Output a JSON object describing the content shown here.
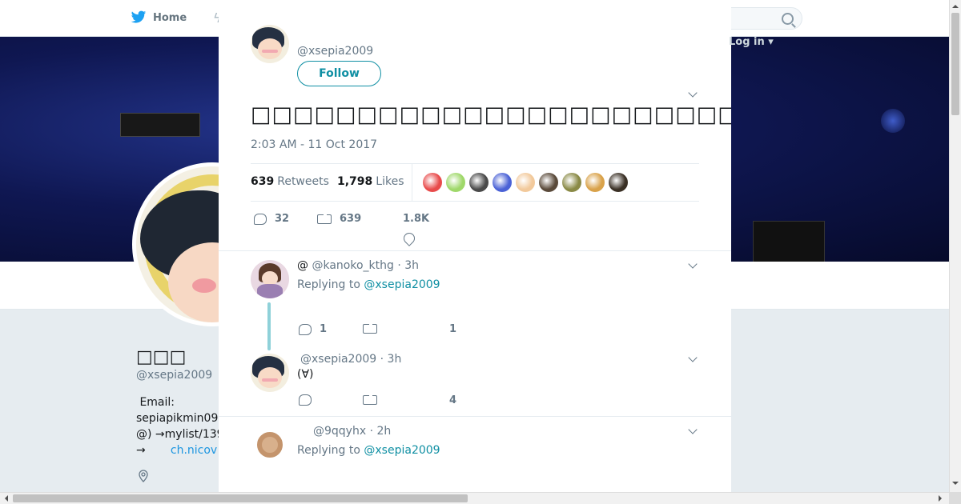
{
  "topnav": {
    "home_label": "Home",
    "login_label": "Log in ▾"
  },
  "profile": {
    "name": "□□□",
    "handle": "@xsepia2009",
    "bio_line1": " Email:",
    "bio_line2": "sepiapikmin09",
    "bio_line3": "@) →mylist/139",
    "bio_line4_prefix": "→",
    "bio_link": "ch.nicov"
  },
  "tweet": {
    "author_handle": "@xsepia2009",
    "follow_label": "Follow",
    "text": "□□□□□□□□□□□□□□□□□□□□□□□□□□□□□□□□□□□□□□□□□□□□□(□)□□□□□□(□)□□□□□□□□□□□□□□□",
    "timestamp": "2:03 AM - 11 Oct 2017",
    "retweets_count": "639",
    "retweets_label": "Retweets",
    "likes_count": "1,798",
    "likes_label": "Likes",
    "liker_colors": [
      "#e84b4b",
      "#9fd86a",
      "#4a4a4a",
      "#4b62d6",
      "#f2c99b",
      "#5a4a3a",
      "#8a8a46",
      "#d9a24a",
      "#3a3025"
    ],
    "reply_count": "32",
    "retweet_action_count": "639",
    "like_action_count": "1.8K"
  },
  "replies": [
    {
      "name": "@",
      "handle": "@kanoko_kthg",
      "time": "3h",
      "replying_prefix": "Replying to",
      "replying_to": "@xsepia2009",
      "reply_count": "1",
      "like_count": "1"
    },
    {
      "handle": "@xsepia2009",
      "time": "3h",
      "text": "(∀)",
      "like_count": "4"
    },
    {
      "handle": "@9qqyhx",
      "time": "2h",
      "replying_prefix": "Replying to",
      "replying_to": "@xsepia2009"
    }
  ],
  "icons": {
    "close": "close-icon",
    "reply": "reply-icon",
    "retweet": "retweet-icon",
    "like": "heart-icon",
    "more": "chevron-down-icon",
    "search": "search-icon",
    "home": "bird-icon",
    "location": "location-pin-icon"
  }
}
